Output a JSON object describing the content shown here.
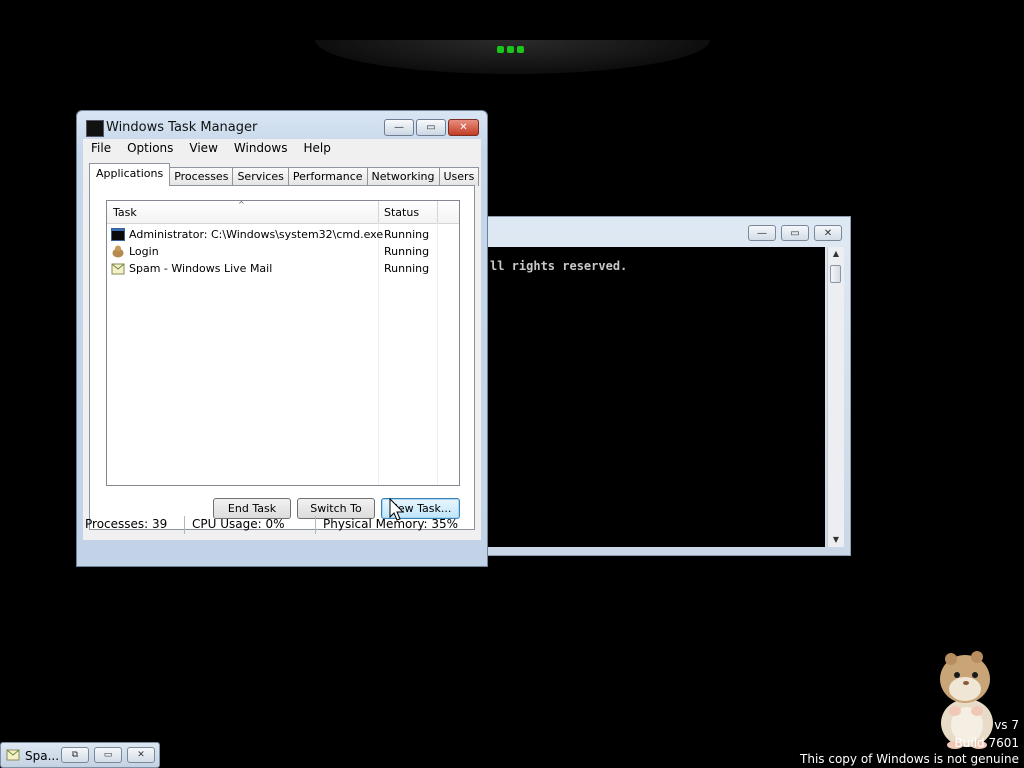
{
  "console": {
    "text_line": "ll rights reserved.",
    "buttons": {
      "minimize": "—",
      "maximize": "▭",
      "close": "✕"
    }
  },
  "task_manager": {
    "title": "Windows Task Manager",
    "window_buttons": {
      "minimize": "—",
      "maximize": "▭",
      "close": "✕"
    },
    "menu": [
      "File",
      "Options",
      "View",
      "Windows",
      "Help"
    ],
    "tabs": [
      "Applications",
      "Processes",
      "Services",
      "Performance",
      "Networking",
      "Users"
    ],
    "active_tab": "Applications",
    "columns": {
      "task": "Task",
      "status": "Status"
    },
    "rows": [
      {
        "task": "Administrator: C:\\Windows\\system32\\cmd.exe",
        "status": "Running",
        "icon": "cmd-icon"
      },
      {
        "task": "Login",
        "status": "Running",
        "icon": "login-app-icon"
      },
      {
        "task": "Spam - Windows Live Mail",
        "status": "Running",
        "icon": "mail-icon"
      }
    ],
    "buttons": {
      "end_task": "End Task",
      "switch_to": "Switch To",
      "new_task": "New Task..."
    },
    "status": {
      "processes": "Processes: 39",
      "cpu": "CPU Usage: 0%",
      "memory": "Physical Memory: 35%"
    }
  },
  "taskbar_thumb": {
    "label": "Spa...",
    "buttons": {
      "restore": "⧉",
      "maximize": "▭",
      "close": "✕"
    }
  },
  "watermark": {
    "line1": "vs 7",
    "line2": "Build 7601",
    "line3": "This copy of Windows is not genuine"
  },
  "colors": {
    "accent_green": "#19c619",
    "close_red": "#c23c25"
  }
}
